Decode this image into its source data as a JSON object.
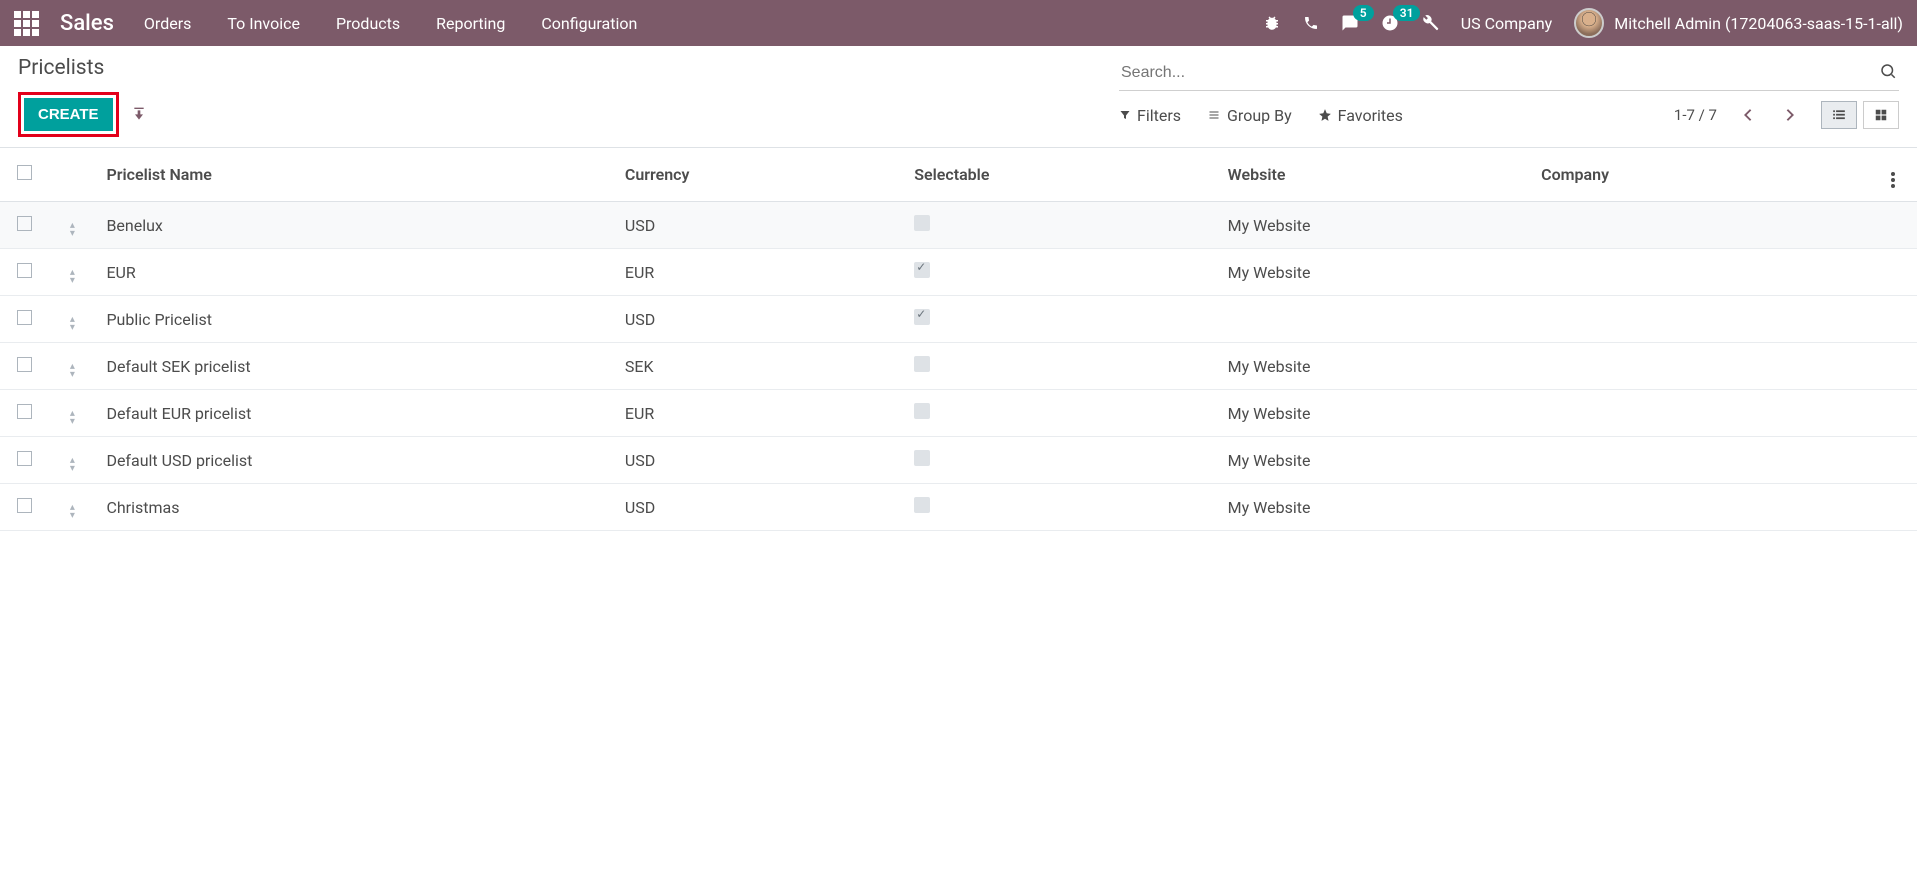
{
  "nav": {
    "brand": "Sales",
    "menu": [
      "Orders",
      "To Invoice",
      "Products",
      "Reporting",
      "Configuration"
    ],
    "msg_badge": "5",
    "activity_badge": "31",
    "company": "US Company",
    "user": "Mitchell Admin (17204063-saas-15-1-all)"
  },
  "cp": {
    "breadcrumb": "Pricelists",
    "create": "CREATE",
    "search_placeholder": "Search...",
    "filters": "Filters",
    "groupby": "Group By",
    "favorites": "Favorites",
    "pager": "1-7 / 7"
  },
  "table": {
    "headers": {
      "name": "Pricelist Name",
      "currency": "Currency",
      "selectable": "Selectable",
      "website": "Website",
      "company": "Company"
    },
    "rows": [
      {
        "name": "Benelux",
        "currency": "USD",
        "selectable": false,
        "website": "My Website",
        "company": ""
      },
      {
        "name": "EUR",
        "currency": "EUR",
        "selectable": true,
        "website": "My Website",
        "company": ""
      },
      {
        "name": "Public Pricelist",
        "currency": "USD",
        "selectable": true,
        "website": "",
        "company": ""
      },
      {
        "name": "Default SEK pricelist",
        "currency": "SEK",
        "selectable": false,
        "website": "My Website",
        "company": ""
      },
      {
        "name": "Default EUR pricelist",
        "currency": "EUR",
        "selectable": false,
        "website": "My Website",
        "company": ""
      },
      {
        "name": "Default USD pricelist",
        "currency": "USD",
        "selectable": false,
        "website": "My Website",
        "company": ""
      },
      {
        "name": "Christmas",
        "currency": "USD",
        "selectable": false,
        "website": "My Website",
        "company": ""
      }
    ]
  }
}
